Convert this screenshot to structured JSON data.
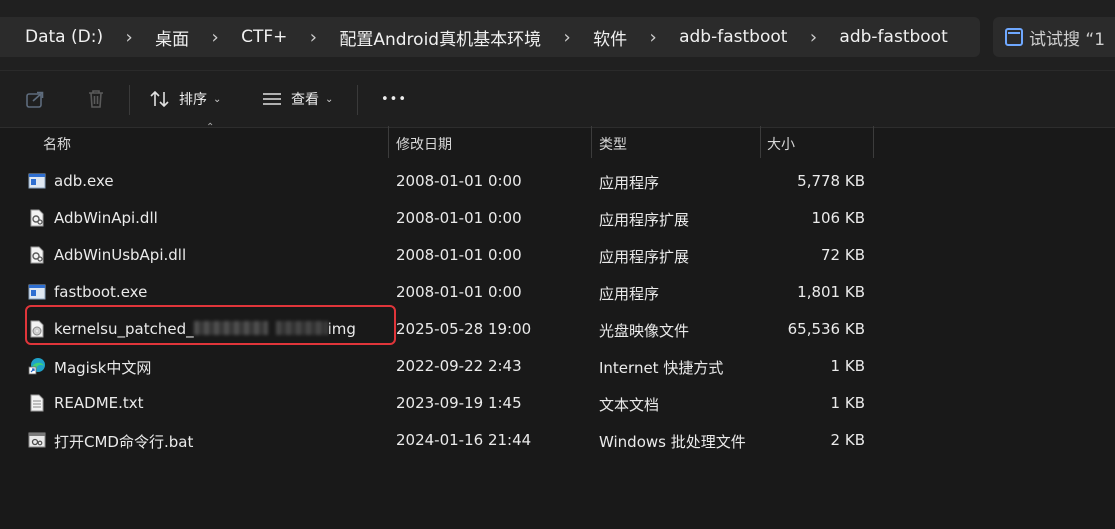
{
  "breadcrumb": {
    "items": [
      "Data (D:)",
      "桌面",
      "CTF+",
      "配置Android真机基本环境",
      "软件",
      "adb-fastboot",
      "adb-fastboot"
    ],
    "separator": "›"
  },
  "search": {
    "text": "试试搜 “1"
  },
  "toolbar": {
    "sort_label": "排序",
    "view_label": "查看",
    "more_label": "•••"
  },
  "columns": {
    "name": "名称",
    "date": "修改日期",
    "type": "类型",
    "size": "大小"
  },
  "files": [
    {
      "name": "adb.exe",
      "date": "2008-01-01 0:00",
      "type": "应用程序",
      "size": "5,778 KB",
      "icon": "exe-icon"
    },
    {
      "name": "AdbWinApi.dll",
      "date": "2008-01-01 0:00",
      "type": "应用程序扩展",
      "size": "106 KB",
      "icon": "dll-icon"
    },
    {
      "name": "AdbWinUsbApi.dll",
      "date": "2008-01-01 0:00",
      "type": "应用程序扩展",
      "size": "72 KB",
      "icon": "dll-icon"
    },
    {
      "name": "fastboot.exe",
      "date": "2008-01-01 0:00",
      "type": "应用程序",
      "size": "1,801 KB",
      "icon": "exe-icon"
    },
    {
      "name_prefix": "kernelsu_patched_",
      "name_suffix": "img",
      "date": "2025-05-28 19:00",
      "type": "光盘映像文件",
      "size": "65,536 KB",
      "icon": "disc-image-icon"
    },
    {
      "name": "Magisk中文网",
      "date": "2022-09-22 2:43",
      "type": "Internet 快捷方式",
      "size": "1 KB",
      "icon": "edge-shortcut-icon"
    },
    {
      "name": "README.txt",
      "date": "2023-09-19 1:45",
      "type": "文本文档",
      "size": "1 KB",
      "icon": "text-file-icon"
    },
    {
      "name": "打开CMD命令行.bat",
      "date": "2024-01-16 21:44",
      "type": "Windows 批处理文件",
      "size": "2 KB",
      "icon": "bat-icon"
    }
  ],
  "colors": {
    "highlight": "#e0353a",
    "accent": "#6fa8ff"
  }
}
